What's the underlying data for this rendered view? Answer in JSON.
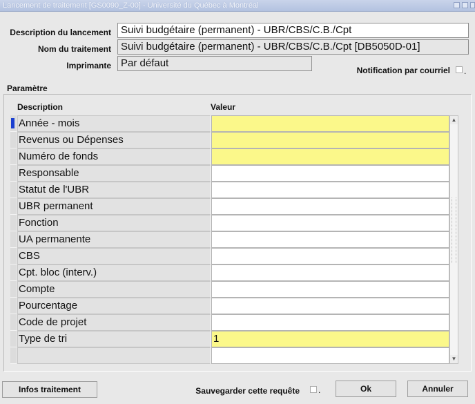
{
  "window": {
    "title": "Lancement de traitement [GS0090_Z-00] - Université du Québec à Montréal"
  },
  "header": {
    "description_label": "Description du lancement",
    "description_value": "Suivi budgétaire (permanent) - UBR/CBS/C.B./Cpt",
    "nom_label": "Nom du traitement",
    "nom_value": "Suivi budgétaire (permanent) - UBR/CBS/C.B./Cpt [DB5050D-01]",
    "imprimante_label": "Imprimante",
    "imprimante_value": "Par défaut",
    "notification_label": "Notification par courriel",
    "notification_checked": false
  },
  "parametres": {
    "section_title": "Paramètre",
    "col_description": "Description",
    "col_valeur": "Valeur",
    "rows": [
      {
        "description": "Année - mois",
        "valeur": "",
        "required": true
      },
      {
        "description": "Revenus ou Dépenses",
        "valeur": "",
        "required": true
      },
      {
        "description": "Numéro de fonds",
        "valeur": "",
        "required": true
      },
      {
        "description": "Responsable",
        "valeur": "",
        "required": false
      },
      {
        "description": "Statut de l'UBR",
        "valeur": "",
        "required": false
      },
      {
        "description": "UBR permanent",
        "valeur": "",
        "required": false
      },
      {
        "description": "Fonction",
        "valeur": "",
        "required": false
      },
      {
        "description": "UA permanente",
        "valeur": "",
        "required": false
      },
      {
        "description": "CBS",
        "valeur": "",
        "required": false
      },
      {
        "description": "Cpt. bloc (interv.)",
        "valeur": "",
        "required": false
      },
      {
        "description": "Compte",
        "valeur": "",
        "required": false
      },
      {
        "description": "Pourcentage",
        "valeur": "",
        "required": false
      },
      {
        "description": "Code de projet",
        "valeur": "",
        "required": false
      },
      {
        "description": "Type de tri",
        "valeur": "1",
        "required": true
      },
      {
        "description": "",
        "valeur": "",
        "required": false
      }
    ]
  },
  "footer": {
    "infos_label": "Infos traitement",
    "sauvegarder_label": "Sauvegarder cette requête",
    "sauvegarder_checked": false,
    "ok_label": "Ok",
    "annuler_label": "Annuler"
  },
  "colors": {
    "required_field": "#fbf88a",
    "active_row_marker": "#1a3fd0",
    "titlebar": "#b3c2e0"
  }
}
